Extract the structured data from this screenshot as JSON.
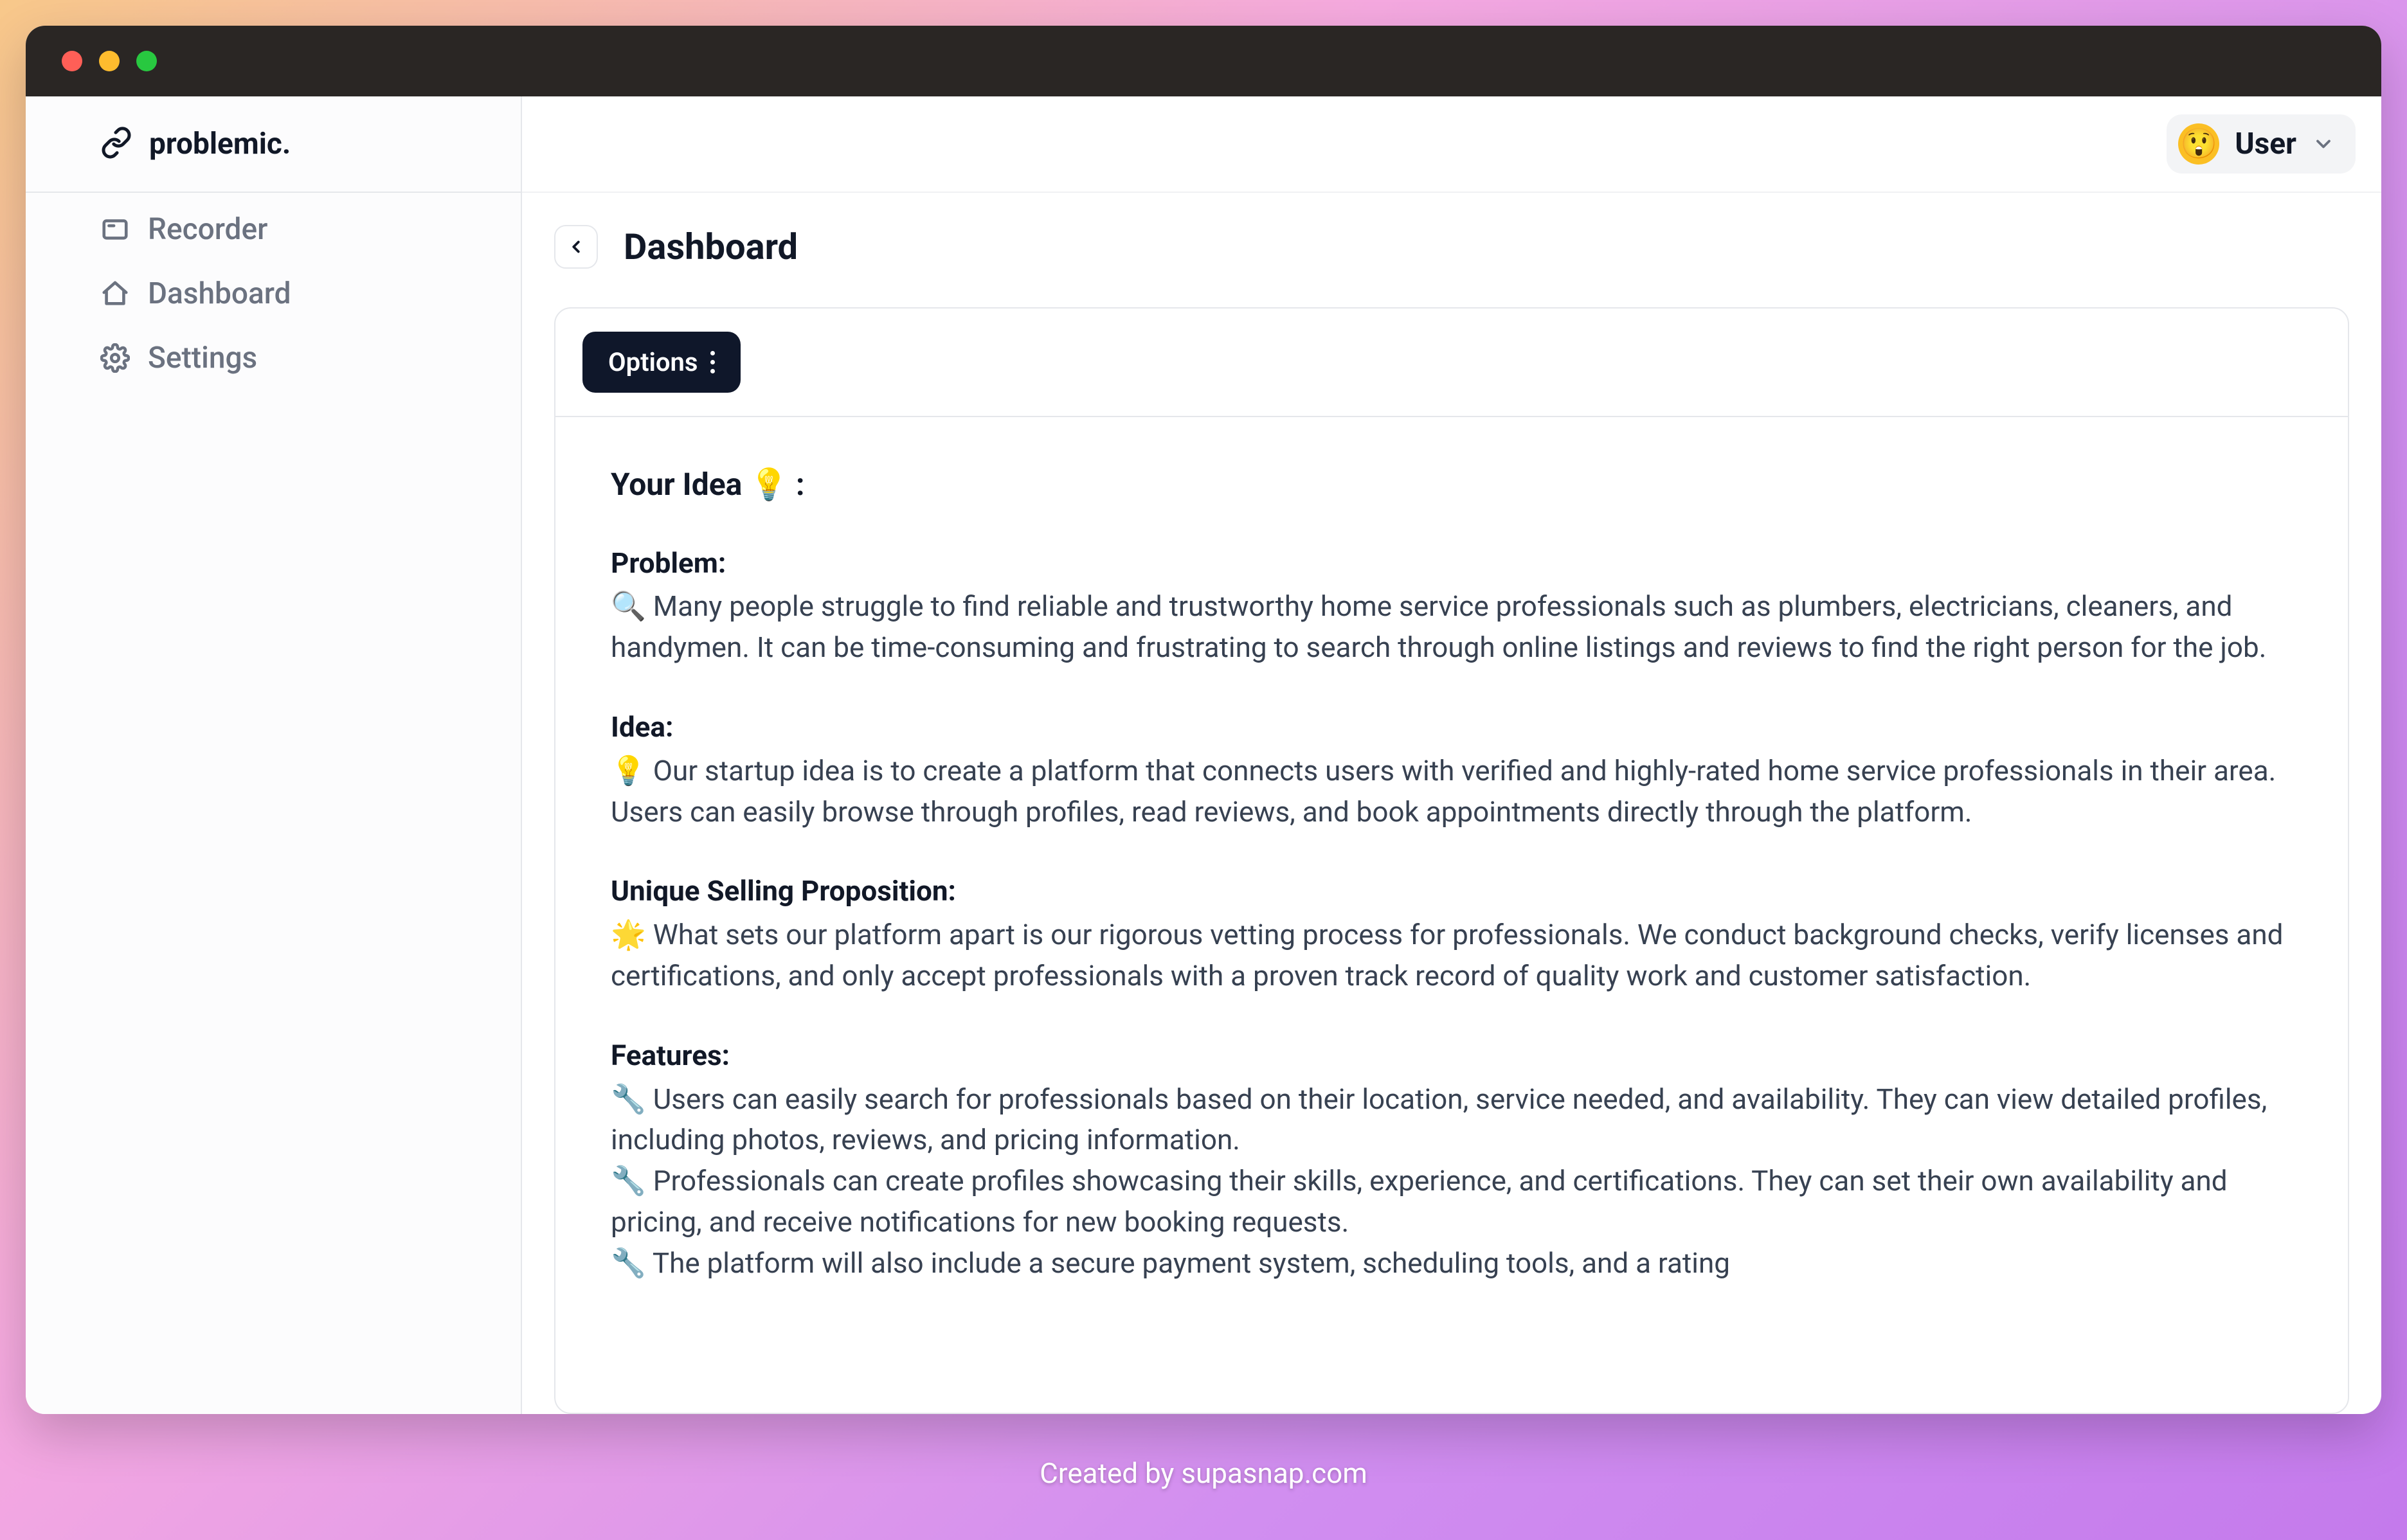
{
  "app": {
    "name": "problemic."
  },
  "sidebar": {
    "items": [
      {
        "label": "Recorder"
      },
      {
        "label": "Dashboard"
      },
      {
        "label": "Settings"
      }
    ]
  },
  "header": {
    "user_label": "User",
    "avatar_emoji": "😲"
  },
  "page": {
    "title": "Dashboard",
    "options_label": "Options"
  },
  "idea": {
    "heading": "Your Idea 💡 :",
    "sections": {
      "problem": {
        "label": "Problem:",
        "body": "🔍 Many people struggle to find reliable and trustworthy home service professionals such as plumbers, electricians, cleaners, and handymen. It can be time-consuming and frustrating to search through online listings and reviews to find the right person for the job."
      },
      "idea": {
        "label": "Idea:",
        "body": "💡 Our startup idea is to create a platform that connects users with verified and highly-rated home service professionals in their area. Users can easily browse through profiles, read reviews, and book appointments directly through the platform."
      },
      "usp": {
        "label": "Unique Selling Proposition:",
        "body": "🌟 What sets our platform apart is our rigorous vetting process for professionals. We conduct background checks, verify licenses and certifications, and only accept professionals with a proven track record of quality work and customer satisfaction."
      },
      "features": {
        "label": "Features:",
        "b1": "🔧 Users can easily search for professionals based on their location, service needed, and availability. They can view detailed profiles, including photos, reviews, and pricing information.",
        "b2": "🔧 Professionals can create profiles showcasing their skills, experience, and certifications. They can set their own availability and pricing, and receive notifications for new booking requests.",
        "b3": "🔧 The platform will also include a secure payment system, scheduling tools, and a rating"
      }
    }
  },
  "footer": {
    "credit": "Created by supasnap.com"
  }
}
